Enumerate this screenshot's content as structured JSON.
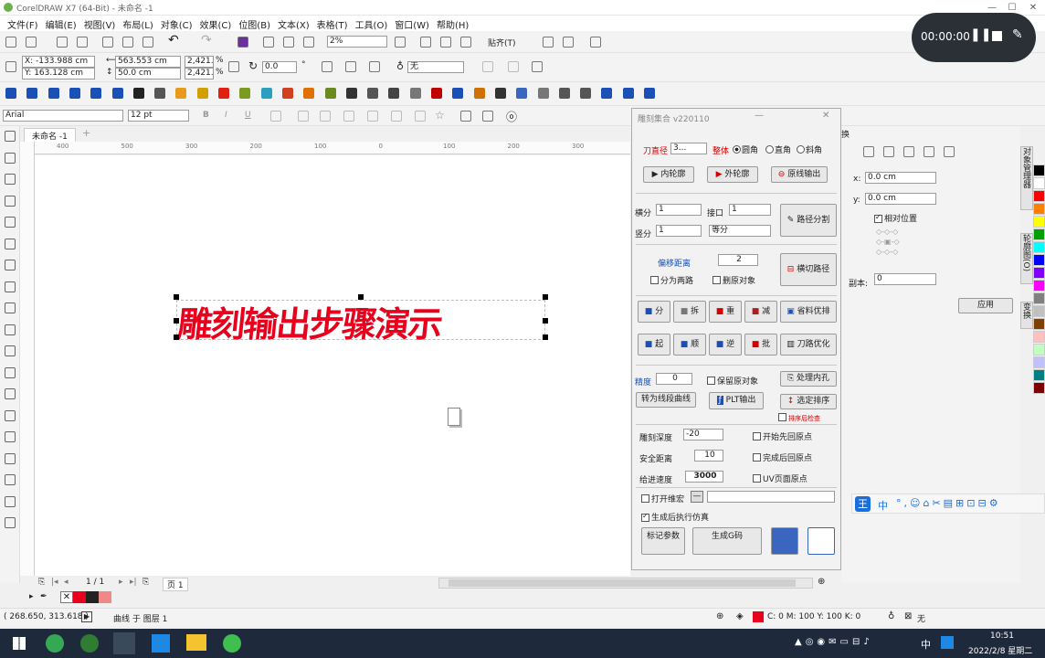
{
  "window": {
    "title": "CorelDRAW X7 (64-Bit) - 未命名 -1",
    "min": "—",
    "max": "☐",
    "close": "✕"
  },
  "menu": [
    "文件(F)",
    "编辑(E)",
    "视图(V)",
    "布局(L)",
    "对象(C)",
    "效果(C)",
    "位图(B)",
    "文本(X)",
    "表格(T)",
    "工具(O)",
    "窗口(W)",
    "帮助(H)"
  ],
  "std_toolbar": {
    "zoom": "2%",
    "snap": "贴齐(T)"
  },
  "prop_bar": {
    "x": "X: -133.988 cm",
    "y": "Y: 163.128 cm",
    "w": "563.553 cm",
    "h": "50.0 cm",
    "sx": "2,421.4",
    "sy": "2,421.4",
    "pct": "%",
    "rot": "0.0",
    "deg": "°",
    "outline": "无"
  },
  "text_toolbar": {
    "font": "Arial",
    "size": "12 pt"
  },
  "doc": {
    "tab": "未命名 -1",
    "canvas_text": "雕刻输出步骤演示"
  },
  "ruler": [
    "400",
    "500",
    "300",
    "200",
    "100",
    "0",
    "100",
    "200",
    "300"
  ],
  "dialog": {
    "title": "雕刻集合 v220110",
    "tool_dia_label": "刀直径",
    "tool_dia_value": "3...",
    "shape_label": "整体",
    "shapes": [
      "圆角",
      "直角",
      "斜角"
    ],
    "btn_inner": "内轮廓",
    "btn_outer": "外轮廓",
    "btn_orig": "原线输出",
    "hsplit_label": "横分",
    "hsplit_value": "1",
    "gap_label": "接口",
    "gap_value": "1",
    "vsplit_label": "竖分",
    "vsplit_value": "1",
    "mode_value": "等分",
    "btn_path_split": "路径分割",
    "offset_label": "偏移距离",
    "offset_value": "2",
    "cb_two_paths": "分为两路",
    "cb_delete_src": "删原对象",
    "btn_cut_path": "横切路径",
    "row1": [
      "分",
      "拆",
      "重",
      "减"
    ],
    "btn_material": "省料优排",
    "row2": [
      "起",
      "顺",
      "逆",
      "批"
    ],
    "btn_path_opt": "刀路优化",
    "precision_label": "精度",
    "precision_value": "0",
    "cb_keep_inner": "保留原对象",
    "btn_holes": "处理内孔",
    "btn_to_curve": "转为线段曲线",
    "btn_plt": "PLT输出",
    "btn_sort": "选定排序",
    "cb_sort_small": "排序后检查",
    "depth_label": "雕刻深度",
    "depth_value": "-20",
    "safe_label": "安全距离",
    "safe_value": "10",
    "feed_label": "给进速度",
    "feed_value": "3000",
    "cb_start_origin": "开始先回原点",
    "cb_end_origin": "完成后回原点",
    "cb_uv": "UV页面原点",
    "cb_open_notepad": "打开维宏",
    "cb_sim": "生成后执行仿真",
    "btn_mark": "标记参数",
    "btn_gen": "生成G码"
  },
  "right_panel": {
    "title": "换",
    "x": "x:",
    "x_value": "0.0 cm",
    "y": "y:",
    "y_value": "0.0 cm",
    "cb_relative": "相对位置",
    "copies_label": "副本:",
    "copies_value": "0",
    "apply": "应用"
  },
  "vtabs": [
    "对象管理器",
    "轮廓图(O)",
    "变换"
  ],
  "recorder": {
    "time": "00:00:00"
  },
  "ime_bar": {
    "label": "王",
    "mode": "中"
  },
  "page_nav": {
    "pages": "1 / 1",
    "page_name": "页 1"
  },
  "status": {
    "coords": "( 268.650, 313.618 )",
    "object": "曲线 于 图层 1",
    "fill": "C: 0 M: 100 Y: 100 K: 0",
    "outline": "无"
  },
  "clock": {
    "time": "10:51",
    "date": "2022/2/8 星期二"
  },
  "tray": {
    "lang": "中",
    "x": "✕"
  },
  "colors": {
    "accent_red": "#e8001c",
    "palette": [
      "#000000",
      "#ffffff",
      "#ff0000",
      "#ff8000",
      "#ffff00",
      "#00a000",
      "#00ffff",
      "#0000ff",
      "#8000ff",
      "#ff00ff",
      "#808080",
      "#c0c0c0",
      "#804000",
      "#ffc0c0",
      "#c0ffc0",
      "#c0c0ff",
      "#008080",
      "#800000"
    ]
  }
}
